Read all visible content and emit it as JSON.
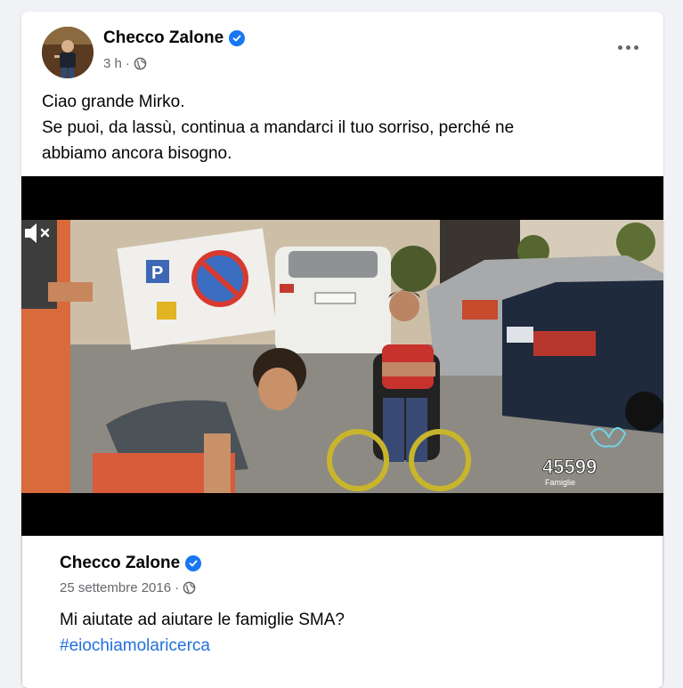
{
  "post": {
    "author": "Checco Zalone",
    "time": "3 h",
    "separator": "·",
    "lines": [
      "Ciao grande Mirko.",
      "Se puoi, da lassù, continua a mandarci il tuo sorriso, perché ne",
      "abbiamo ancora bisogno."
    ]
  },
  "video": {
    "overlay_number": "45599",
    "overlay_caption": "Famiglie",
    "sign_letter": "P"
  },
  "shared_post": {
    "author": "Checco Zalone",
    "date": "25 settembre 2016",
    "separator": "·",
    "text": "Mi aiutate ad aiutare le famiglie SMA?",
    "hashtag": "#eiochiamolaricerca"
  },
  "icons": {
    "verified": "verified-badge-icon",
    "globe": "globe-icon",
    "more": "more-options-icon",
    "mute": "muted-speaker-icon"
  },
  "colors": {
    "brand_blue": "#1877f2",
    "link": "#216fdb",
    "secondary_text": "#65676b"
  }
}
